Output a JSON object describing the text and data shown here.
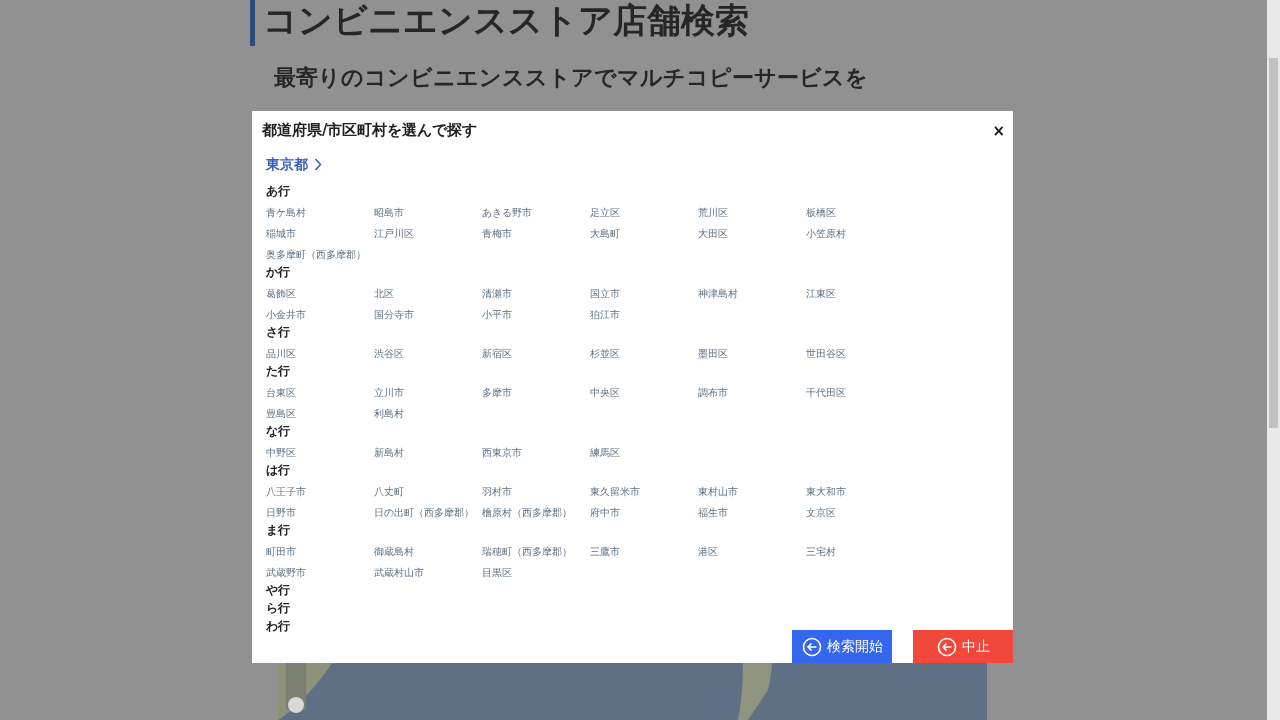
{
  "page": {
    "title": "コンビニエンスストア店舗検索",
    "subtitle_lines": [
      "最寄りのコンビニエンスストアでマルチコピーサービスを"
    ]
  },
  "dialog": {
    "title": "都道府県/市区町村を選んで探す",
    "close": "×",
    "prefecture": "東京都",
    "groups": [
      {
        "label": "あ行",
        "items": [
          "青ケ島村",
          "昭島市",
          "あきる野市",
          "足立区",
          "荒川区",
          "板橋区",
          "稲城市",
          "江戸川区",
          "青梅市",
          "大島町",
          "大田区",
          "小笠原村",
          "奥多摩町（西多摩郡）"
        ]
      },
      {
        "label": "か行",
        "items": [
          "葛飾区",
          "北区",
          "清瀬市",
          "国立市",
          "神津島村",
          "江東区",
          "小金井市",
          "国分寺市",
          "小平市",
          "狛江市"
        ]
      },
      {
        "label": "さ行",
        "items": [
          "品川区",
          "渋谷区",
          "新宿区",
          "杉並区",
          "墨田区",
          "世田谷区"
        ]
      },
      {
        "label": "た行",
        "items": [
          "台東区",
          "立川市",
          "多摩市",
          "中央区",
          "調布市",
          "千代田区",
          "豊島区",
          "利島村"
        ]
      },
      {
        "label": "な行",
        "items": [
          "中野区",
          "新島村",
          "西東京市",
          "練馬区"
        ]
      },
      {
        "label": "は行",
        "items": [
          "八王子市",
          "八丈町",
          "羽村市",
          "東久留米市",
          "東村山市",
          "東大和市",
          "日野市",
          "日の出町（西多摩郡）",
          "檜原村（西多摩郡）",
          "府中市",
          "福生市",
          "文京区"
        ]
      },
      {
        "label": "ま行",
        "items": [
          "町田市",
          "御蔵島村",
          "瑞穂町（西多摩郡）",
          "三鷹市",
          "港区",
          "三宅村",
          "武蔵野市",
          "武蔵村山市",
          "目黒区"
        ]
      },
      {
        "label": "や行"
      },
      {
        "label": "ら行"
      },
      {
        "label": "わ行"
      }
    ],
    "buttons": [
      {
        "label": "検索開始",
        "kind": "primary"
      },
      {
        "label": "中止",
        "kind": "danger"
      }
    ]
  }
}
